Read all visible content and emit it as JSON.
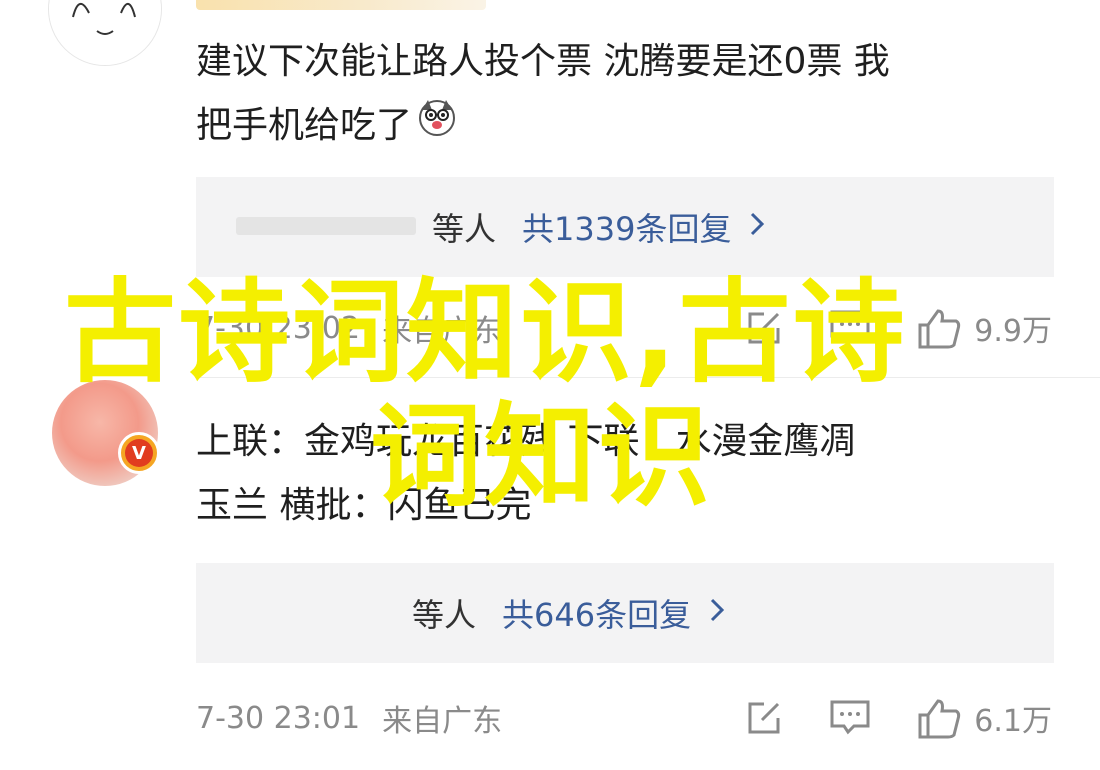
{
  "comments": [
    {
      "text_line1": "建议下次能让路人投个票 沈腾要是还0票 我",
      "text_line2": "把手机给吃了",
      "emoji_icon": "dog-face-emoji",
      "reply_names": "等人",
      "reply_count": "共1339条回复",
      "time": "7-30 23:02",
      "location": "来自广东",
      "likes": "9.9万"
    },
    {
      "text_line1": "上联：金鸡玩龙百花残 下联：水漫金鹰凋",
      "text_line2": "玉兰 横批：闪鱼已完",
      "verified_badge": "V",
      "reply_names": "等人",
      "reply_count": "共646条回复",
      "time": "7-30 23:01",
      "location": "来自广东",
      "likes": "6.1万"
    }
  ],
  "overlay": {
    "line1": "古诗词知识,古诗",
    "line2": "词知识"
  },
  "colors": {
    "overlay": "#f4ef00",
    "link": "#3a5d9a",
    "meta": "#8a8a8a",
    "reply_bg": "#f3f3f4"
  }
}
